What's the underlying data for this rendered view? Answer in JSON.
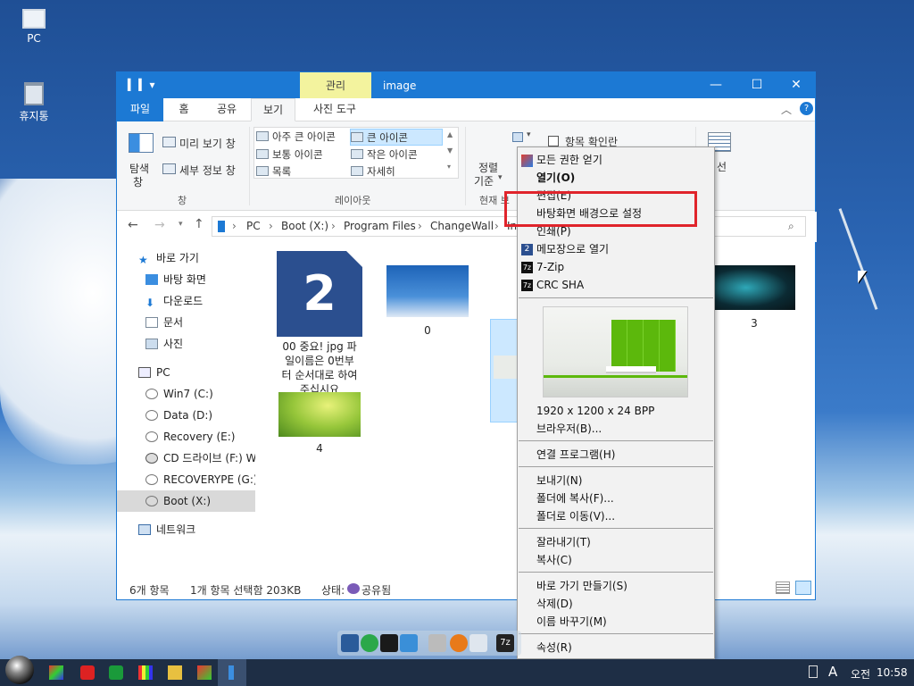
{
  "desktop": {
    "icons": [
      {
        "label": "PC",
        "icon": "pc-icon"
      },
      {
        "label": "휴지통",
        "icon": "recycle-bin-icon"
      }
    ]
  },
  "window": {
    "manage_tab": "관리",
    "title": "image",
    "tabs": [
      {
        "label": "파일"
      },
      {
        "label": "홈"
      },
      {
        "label": "공유"
      },
      {
        "label": "보기"
      },
      {
        "label": "사진 도구"
      }
    ],
    "ribbon": {
      "pane_nav": "탐색",
      "pane_nav2": "창",
      "preview": "미리 보기 창",
      "details_pane": "세부 정보 창",
      "pane_group": "창",
      "layout": [
        "아주 큰 아이콘",
        "큰 아이콘",
        "보통 아이콘",
        "작은 아이콘",
        "목록",
        "자세히"
      ],
      "layout_group": "레이아웃",
      "sort": "정렬",
      "sort2": "기준",
      "current_group": "현재 보",
      "item_check": "항목 확인란",
      "right_cut": "선"
    },
    "address": {
      "path": [
        "PC",
        "Boot (X:)",
        "Program Files",
        "ChangeWall",
        "In"
      ]
    },
    "nav": [
      {
        "label": "바로 가기"
      },
      {
        "label": "바탕 화면"
      },
      {
        "label": "다운로드"
      },
      {
        "label": "문서"
      },
      {
        "label": "사진"
      },
      {
        "label": "PC"
      },
      {
        "label": "Win7 (C:)"
      },
      {
        "label": "Data (D:)"
      },
      {
        "label": "Recovery (E:)"
      },
      {
        "label": "CD 드라이브 (F:) W"
      },
      {
        "label": "RECOVERYPE (G:)"
      },
      {
        "label": "Boot (X:)"
      },
      {
        "label": "네트워크"
      }
    ],
    "items": [
      {
        "label": "00 중요! jpg 파\n일이름은 0번부\n터 순서대로 하여\n주십시요",
        "glyph": "2"
      },
      {
        "label": "0"
      },
      {
        "label": ""
      },
      {
        "label": "3"
      },
      {
        "label": "4"
      }
    ],
    "status": {
      "count": "6개 항목",
      "selected": "1개 항목 선택함 203KB",
      "state_label": "상태:",
      "state_value": "공유됨"
    }
  },
  "context_menu": {
    "items": [
      "모든 권한 얻기",
      "열기(O)",
      "편집(E)",
      "바탕화면 배경으로 설정",
      "인쇄(P)",
      "메모장으로 열기",
      "7-Zip",
      "CRC SHA"
    ],
    "preview_info": "1920 x 1200 x 24 BPP",
    "browser": "브라우저(B)...",
    "open_with": "연결 프로그램(H)",
    "send": [
      "보내기(N)",
      "폴더에 복사(F)...",
      "폴더로 이동(V)..."
    ],
    "edit": [
      "잘라내기(T)",
      "복사(C)"
    ],
    "file_ops": [
      "바로 가기 만들기(S)",
      "삭제(D)",
      "이름 바꾸기(M)"
    ],
    "props": "속성(R)"
  },
  "taskbar": {
    "lang": "A",
    "ampm": "오전",
    "time": "10:58"
  },
  "colors": {
    "accent": "#1c79d4",
    "manage": "#f3f39e",
    "highlight_box": "#e0242b"
  }
}
